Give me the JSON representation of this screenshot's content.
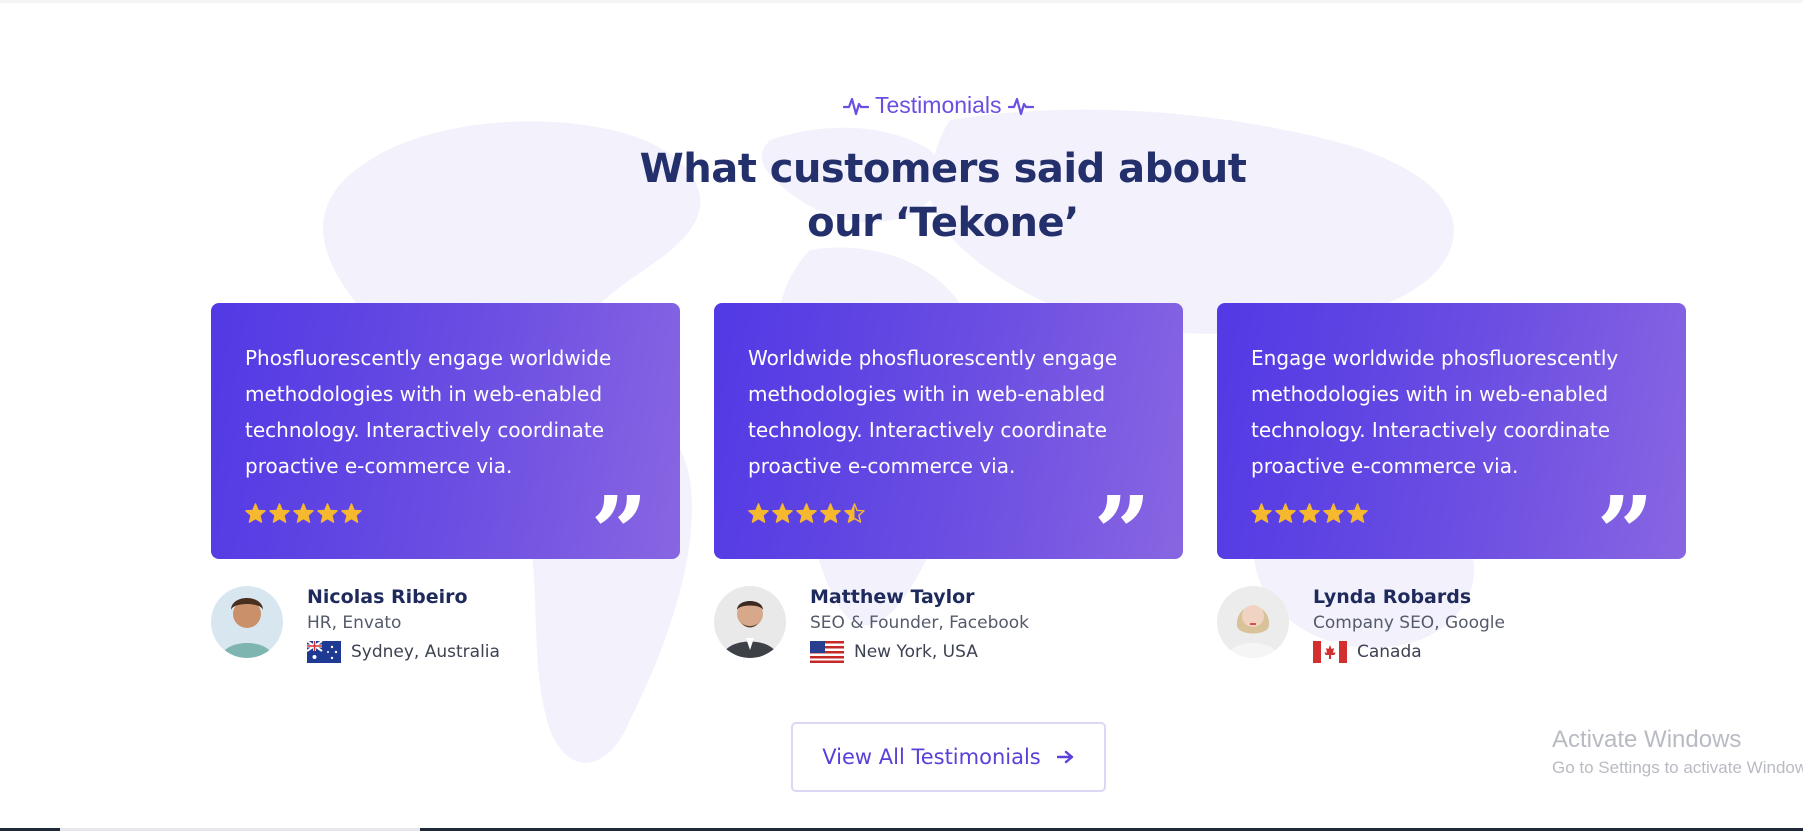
{
  "section": {
    "eyebrow": "Testimonials",
    "heading_line1": "What customers said about",
    "heading_line2": "our ‘Tekone’"
  },
  "testimonials": [
    {
      "quote": "Phosfluorescently engage worldwide methodologies with in web-enabled technology. Interactively coordinate proactive e-commerce via.",
      "rating": 5,
      "name": "Nicolas Ribeiro",
      "role": "HR, Envato",
      "location": "Sydney, Australia",
      "flag": "australia-flag"
    },
    {
      "quote": "Worldwide phosfluorescently engage methodologies with in web-enabled technology. Interactively coordinate proactive e-commerce via.",
      "rating": 4.5,
      "name": "Matthew Taylor",
      "role": "SEO & Founder, Facebook",
      "location": "New York, USA",
      "flag": "usa-flag"
    },
    {
      "quote": "Engage worldwide phosfluorescently methodologies with in web-enabled technology. Interactively coordinate proactive e-commerce via.",
      "rating": 5,
      "name": "Lynda Robards",
      "role": "Company SEO, Google",
      "location": "Canada",
      "flag": "canada-flag"
    }
  ],
  "cta": {
    "label": "View All Testimonials",
    "icon": "arrow-right-icon"
  },
  "watermark": {
    "title": "Activate Windows",
    "subtitle": "Go to Settings to activate Windows."
  },
  "colors": {
    "accent": "#5a3fd9",
    "heading": "#23306b",
    "card_start": "#5139e4",
    "card_end": "#8866e2",
    "star": "#f5b82e"
  }
}
